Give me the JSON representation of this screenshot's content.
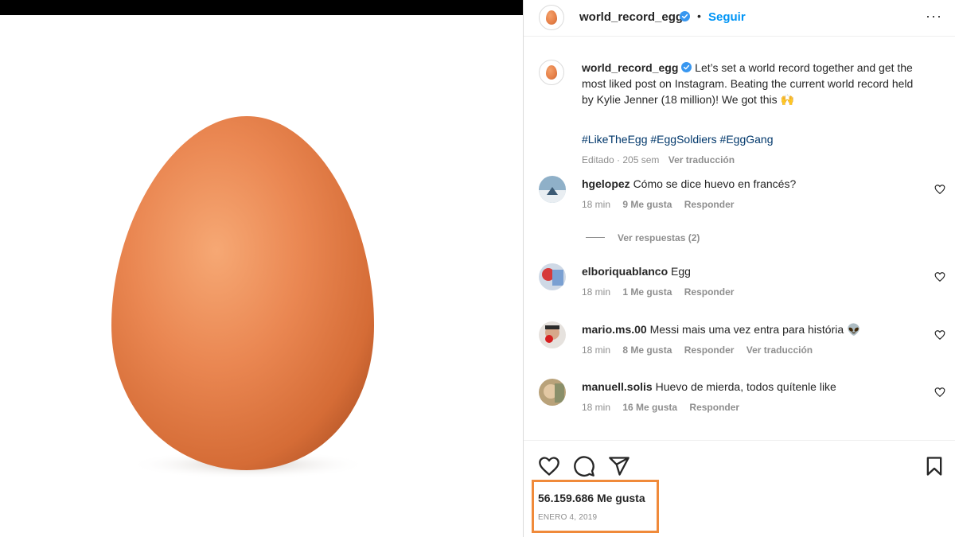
{
  "post": {
    "username": "world_record_egg",
    "follow_label": "Seguir",
    "separator": "•",
    "more_label": "···"
  },
  "caption": {
    "username": "world_record_egg",
    "text": "Let’s set a world record together and get the most liked post on Instagram. Beating the current world record held by Kylie Jenner (18 million)! We got this 🙌",
    "hashtags": "#LikeTheEgg #EggSoldiers #EggGang",
    "edited": "Editado · 205 sem",
    "translate": "Ver traducción"
  },
  "comments": [
    {
      "username": "hgelopez",
      "text": "Cómo se dice huevo en francés?",
      "time": "18 min",
      "likes": "9 Me gusta",
      "reply": "Responder",
      "translate": ""
    },
    {
      "username": "elboriquablanco",
      "text": "Egg",
      "time": "18 min",
      "likes": "1 Me gusta",
      "reply": "Responder",
      "translate": ""
    },
    {
      "username": "mario.ms.00",
      "text": "Messi mais uma vez entra para história 👽",
      "time": "18 min",
      "likes": "8 Me gusta",
      "reply": "Responder",
      "translate": "Ver traducción"
    },
    {
      "username": "manuell.solis",
      "text": "Huevo de mierda, todos quítenle like",
      "time": "18 min",
      "likes": "16 Me gusta",
      "reply": "Responder",
      "translate": ""
    }
  ],
  "view_replies": "Ver respuestas (2)",
  "footer": {
    "likes": "56.159.686 Me gusta",
    "date": "ENERO 4, 2019"
  },
  "colors": {
    "accent_blue": "#0095f6",
    "link_dark_blue": "#00376b",
    "verified": "#3897f0",
    "highlight_box": "#f08a3a",
    "egg": "#e7824a"
  },
  "icons": [
    "verified-badge-icon",
    "more-options-icon",
    "heart-icon",
    "comment-icon",
    "share-icon",
    "bookmark-icon"
  ]
}
